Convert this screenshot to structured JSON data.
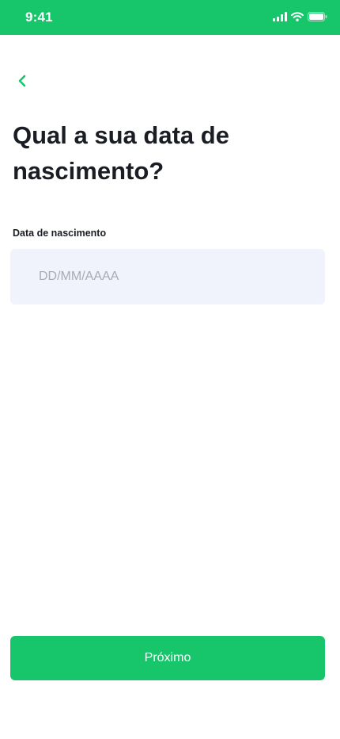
{
  "status_bar": {
    "time": "9:41",
    "icons": [
      "signal-icon",
      "wifi-icon",
      "battery-icon"
    ]
  },
  "colors": {
    "brand_green": "#17C56B",
    "title_text": "#1A1D24",
    "input_background": "#F0F3FC",
    "placeholder_text": "#A7ABB6"
  },
  "header": {
    "back_icon": "chevron-left-icon"
  },
  "page": {
    "title": "Qual a sua data de nascimento?"
  },
  "form": {
    "birthdate_label": "Data de nascimento",
    "birthdate_value": "",
    "birthdate_placeholder": "DD/MM/AAAA"
  },
  "actions": {
    "next_label": "Próximo"
  }
}
